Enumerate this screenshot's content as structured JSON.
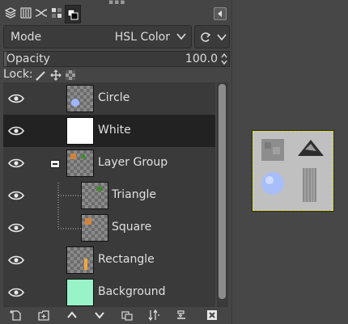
{
  "tabs": [
    {
      "icon": "layers-icon",
      "active": false
    },
    {
      "icon": "channels-icon",
      "active": false
    },
    {
      "icon": "paths-icon",
      "active": false
    },
    {
      "icon": "undo-history-icon",
      "active": false
    },
    {
      "icon": "colors-icon",
      "active": true
    }
  ],
  "mode": {
    "label": "Mode",
    "value": "HSL Color"
  },
  "opacity": {
    "label": "Opacity",
    "value": "100.0",
    "percent": 100
  },
  "lock": {
    "label": "Lock:",
    "icons": [
      "lock-pixels-icon",
      "lock-position-icon",
      "lock-alpha-icon"
    ]
  },
  "layers": [
    {
      "name": "Circle",
      "visible": true,
      "thumb": "circle",
      "selected": false,
      "indent": 0
    },
    {
      "name": "White",
      "visible": true,
      "thumb": "white",
      "selected": true,
      "indent": 0
    },
    {
      "name": "Layer Group",
      "visible": true,
      "thumb": "group",
      "selected": false,
      "indent": 0,
      "expanded": true
    },
    {
      "name": "Triangle",
      "visible": true,
      "thumb": "triangle",
      "selected": false,
      "indent": 1
    },
    {
      "name": "Square",
      "visible": true,
      "thumb": "square",
      "selected": false,
      "indent": 1
    },
    {
      "name": "Rectangle",
      "visible": true,
      "thumb": "rectangle",
      "selected": false,
      "indent": 0
    },
    {
      "name": "Background",
      "visible": true,
      "thumb": "background",
      "selected": false,
      "indent": 0
    }
  ],
  "bottom_buttons": [
    "new-layer-icon",
    "new-layer-group-icon",
    "raise-layer-icon",
    "lower-layer-icon",
    "duplicate-layer-icon",
    "anchor-layer-icon",
    "merge-down-icon",
    "delete-layer-icon"
  ],
  "colors": {
    "accent_dark": "#222222",
    "mint": "#9af2c9",
    "selection_dash": "#e5e600"
  }
}
